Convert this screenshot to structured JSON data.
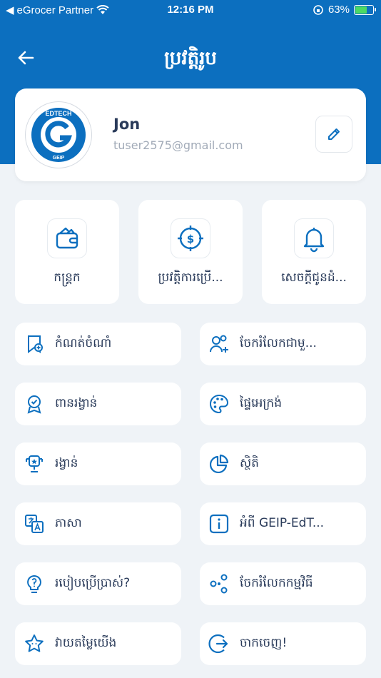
{
  "status": {
    "carrier": "eGrocer Partner",
    "time": "12:16 PM",
    "battery": "63%"
  },
  "nav": {
    "title": "ប្រវត្តិរូប"
  },
  "profile": {
    "name": "Jon",
    "email": "tuser2575@gmail.com",
    "logo_text_top": "EDTECH",
    "logo_text_side": "GEIP"
  },
  "tiles": [
    {
      "label": "កន្ត្រក",
      "icon": "wallet-icon"
    },
    {
      "label": "ប្រវត្តិការប្រើ...",
      "icon": "coin-target-icon"
    },
    {
      "label": "សេចក្តីជូនដំ...",
      "icon": "bell-icon"
    }
  ],
  "menu": [
    {
      "label": "កំណត់ចំណាំ",
      "icon": "bookmark-add-icon"
    },
    {
      "label": "ចែករំលែកជាមួ...",
      "icon": "user-add-icon"
    },
    {
      "label": "ពានរង្វាន់",
      "icon": "award-icon"
    },
    {
      "label": "ផ្ទៃអេក្រង់",
      "icon": "palette-icon"
    },
    {
      "label": "រង្វាន់",
      "icon": "trophy-icon"
    },
    {
      "label": "ស្ថិតិ",
      "icon": "pie-chart-icon"
    },
    {
      "label": "ភាសា",
      "icon": "translate-icon"
    },
    {
      "label": "អំពី GEIP-EdT...",
      "icon": "info-icon"
    },
    {
      "label": "របៀបប្រើប្រាស់?",
      "icon": "lightbulb-icon"
    },
    {
      "label": "ចែករំលែកកម្មវិធី",
      "icon": "share-icon"
    },
    {
      "label": "វាយតម្លៃយើង",
      "icon": "star-icon"
    },
    {
      "label": "ចាកចេញ!",
      "icon": "logout-icon"
    }
  ],
  "colors": {
    "primary": "#0c6fbf",
    "background": "#eff3f7",
    "text": "#2a3b5a",
    "muted": "#a2abb8"
  }
}
